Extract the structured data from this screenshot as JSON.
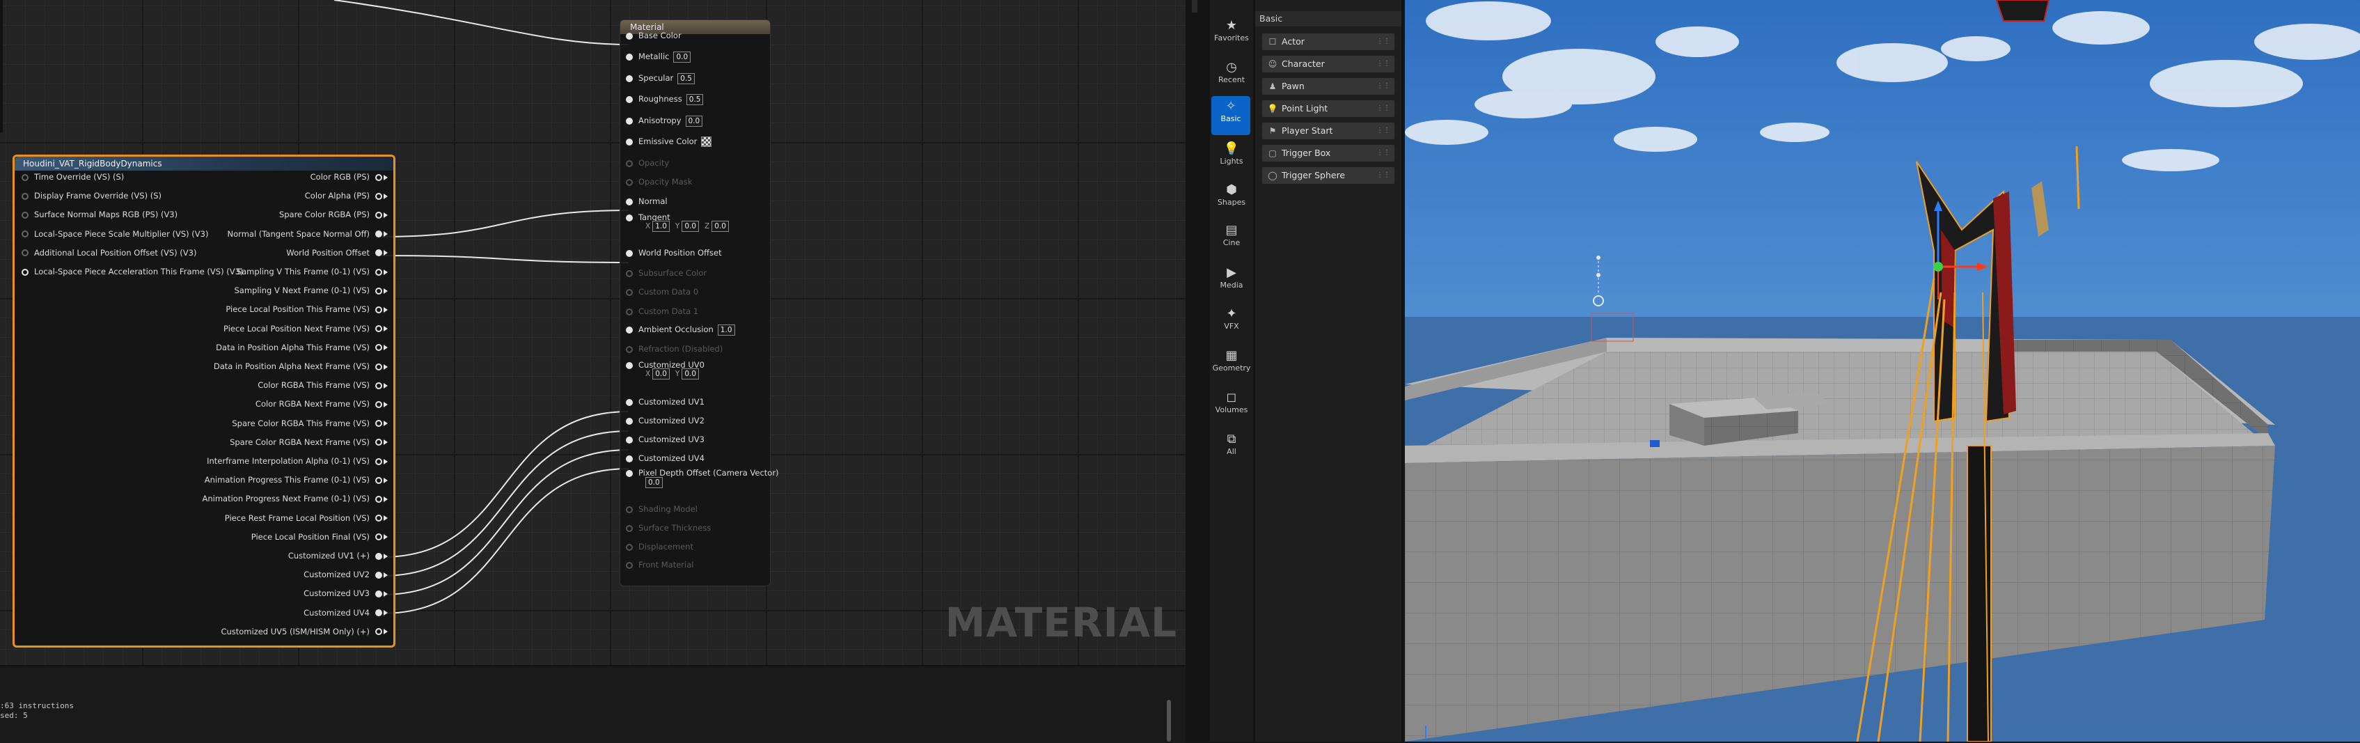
{
  "material_node": {
    "title": "Material",
    "pins": [
      {
        "label": "Base Color",
        "enabled": true
      },
      {
        "label": "Metallic",
        "enabled": true,
        "value": "0.0"
      },
      {
        "label": "Specular",
        "enabled": true,
        "value": "0.5"
      },
      {
        "label": "Roughness",
        "enabled": true,
        "value": "0.5"
      },
      {
        "label": "Anisotropy",
        "enabled": true,
        "value": "0.0"
      },
      {
        "label": "Emissive Color",
        "enabled": true
      },
      {
        "label": "Opacity",
        "enabled": false
      },
      {
        "label": "Opacity Mask",
        "enabled": false
      },
      {
        "label": "Normal",
        "enabled": true
      },
      {
        "label": "Tangent",
        "enabled": true,
        "x": "1.0",
        "y": "0.0",
        "z": "0.0"
      },
      {
        "label": "World Position Offset",
        "enabled": true
      },
      {
        "label": "Subsurface Color",
        "enabled": false
      },
      {
        "label": "Custom Data 0",
        "enabled": false
      },
      {
        "label": "Custom Data 1",
        "enabled": false
      },
      {
        "label": "Ambient Occlusion",
        "enabled": true,
        "value": "1.0"
      },
      {
        "label": "Refraction (Disabled)",
        "enabled": false
      },
      {
        "label": "Customized UV0",
        "enabled": true,
        "x": "0.0",
        "y": "0.0"
      },
      {
        "label": "Customized UV1",
        "enabled": true
      },
      {
        "label": "Customized UV2",
        "enabled": true
      },
      {
        "label": "Customized UV3",
        "enabled": true
      },
      {
        "label": "Customized UV4",
        "enabled": true
      },
      {
        "label": "Pixel Depth Offset (Camera Vector)",
        "enabled": true,
        "value": "0.0"
      },
      {
        "label": "Shading Model",
        "enabled": false
      },
      {
        "label": "Surface Thickness",
        "enabled": false
      },
      {
        "label": "Displacement",
        "enabled": false
      },
      {
        "label": "Front Material",
        "enabled": false
      }
    ],
    "axis_labels": {
      "x": "X",
      "y": "Y",
      "z": "Z"
    }
  },
  "houdini_node": {
    "title": "Houdini_VAT_RigidBodyDynamics",
    "inputs": [
      "Time Override (VS) (S)",
      "Display Frame Override (VS) (S)",
      "Surface Normal Maps RGB (PS) (V3)",
      "Local-Space Piece Scale Multiplier (VS) (V3)",
      "Additional Local Position Offset (VS) (V3)",
      "Local-Space Piece Acceleration This Frame (VS) (V3)"
    ],
    "outputs": [
      {
        "label": "Color RGB (PS)",
        "connected": false
      },
      {
        "label": "Color Alpha (PS)",
        "connected": false
      },
      {
        "label": "Spare Color RGBA (PS)",
        "connected": false
      },
      {
        "label": "Normal (Tangent Space Normal Off)",
        "connected": true
      },
      {
        "label": "World Position Offset",
        "connected": true
      },
      {
        "label": "Sampling V This Frame (0-1) (VS)",
        "connected": false
      },
      {
        "label": "Sampling V Next Frame (0-1) (VS)",
        "connected": false
      },
      {
        "label": "Piece Local Position This Frame (VS)",
        "connected": false
      },
      {
        "label": "Piece Local Position Next Frame (VS)",
        "connected": false
      },
      {
        "label": "Data in Position Alpha This Frame (VS)",
        "connected": false
      },
      {
        "label": "Data in Position Alpha Next Frame (VS)",
        "connected": false
      },
      {
        "label": "Color RGBA This Frame (VS)",
        "connected": false
      },
      {
        "label": "Color RGBA Next Frame (VS)",
        "connected": false
      },
      {
        "label": "Spare Color RGBA This Frame (VS)",
        "connected": false
      },
      {
        "label": "Spare Color RGBA Next Frame (VS)",
        "connected": false
      },
      {
        "label": "Interframe Interpolation Alpha (0-1) (VS)",
        "connected": false
      },
      {
        "label": "Animation Progress This Frame (0-1) (VS)",
        "connected": false
      },
      {
        "label": "Animation Progress Next Frame (0-1) (VS)",
        "connected": false
      },
      {
        "label": "Piece Rest Frame Local Position (VS)",
        "connected": false
      },
      {
        "label": "Piece Local Position Final (VS)",
        "connected": false
      },
      {
        "label": "Customized UV1 (+)",
        "connected": true
      },
      {
        "label": "Customized UV2",
        "connected": true
      },
      {
        "label": "Customized UV3",
        "connected": true
      },
      {
        "label": "Customized UV4",
        "connected": true
      },
      {
        "label": "Customized UV5 (ISM/HISM Only) (+)",
        "connected": false
      }
    ]
  },
  "watermark": "MATERIAL",
  "stats": {
    "line1": ":63 instructions",
    "line2": "sed: 5"
  },
  "place_actors": {
    "section": "Basic",
    "categories": [
      {
        "label": "Favorites",
        "icon": "★",
        "active": false
      },
      {
        "label": "Recent",
        "icon": "◷",
        "active": false
      },
      {
        "label": "Basic",
        "icon": "✧",
        "active": true
      },
      {
        "label": "Lights",
        "icon": "💡",
        "active": false
      },
      {
        "label": "Shapes",
        "icon": "⬢",
        "active": false
      },
      {
        "label": "Cine",
        "icon": "▤",
        "active": false
      },
      {
        "label": "Media",
        "icon": "▶",
        "active": false
      },
      {
        "label": "VFX",
        "icon": "✦",
        "active": false
      },
      {
        "label": "Geometry",
        "icon": "▦",
        "active": false
      },
      {
        "label": "Volumes",
        "icon": "◻",
        "active": false
      },
      {
        "label": "All",
        "icon": "⧉",
        "active": false
      }
    ],
    "items": [
      {
        "label": "Actor",
        "icon": "☐"
      },
      {
        "label": "Character",
        "icon": "☺"
      },
      {
        "label": "Pawn",
        "icon": "♟"
      },
      {
        "label": "Point Light",
        "icon": "💡"
      },
      {
        "label": "Player Start",
        "icon": "⚑"
      },
      {
        "label": "Trigger Box",
        "icon": "▢"
      },
      {
        "label": "Trigger Sphere",
        "icon": "◯"
      }
    ]
  },
  "colors": {
    "accent": "#0a63c6",
    "selection": "#f0a020",
    "node_border": "#e8921e"
  }
}
